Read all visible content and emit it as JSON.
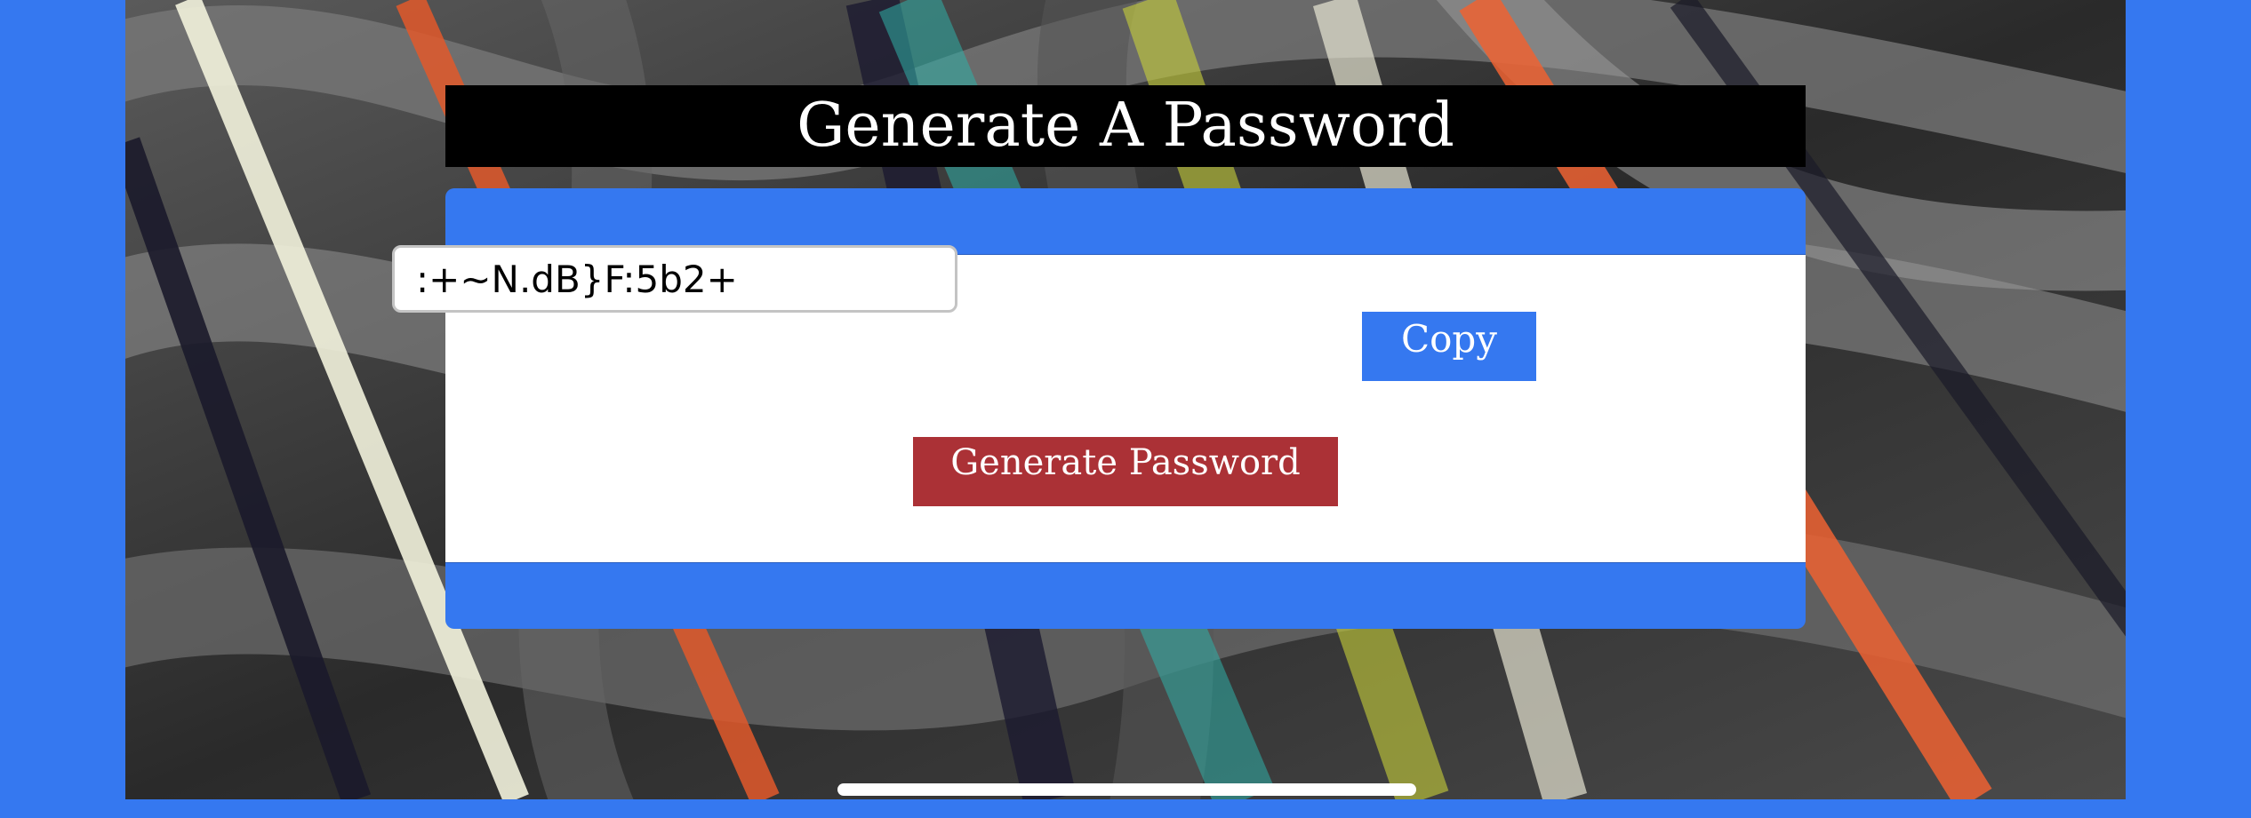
{
  "header": {
    "title": "Generate A Password"
  },
  "password_field": {
    "value": ":+~N.dB}F:5b2+"
  },
  "buttons": {
    "copy_label": "Copy",
    "generate_label": "Generate Password"
  },
  "colors": {
    "accent_blue": "#3578f0",
    "generate_red": "#ab3136",
    "title_bar": "#000000"
  }
}
